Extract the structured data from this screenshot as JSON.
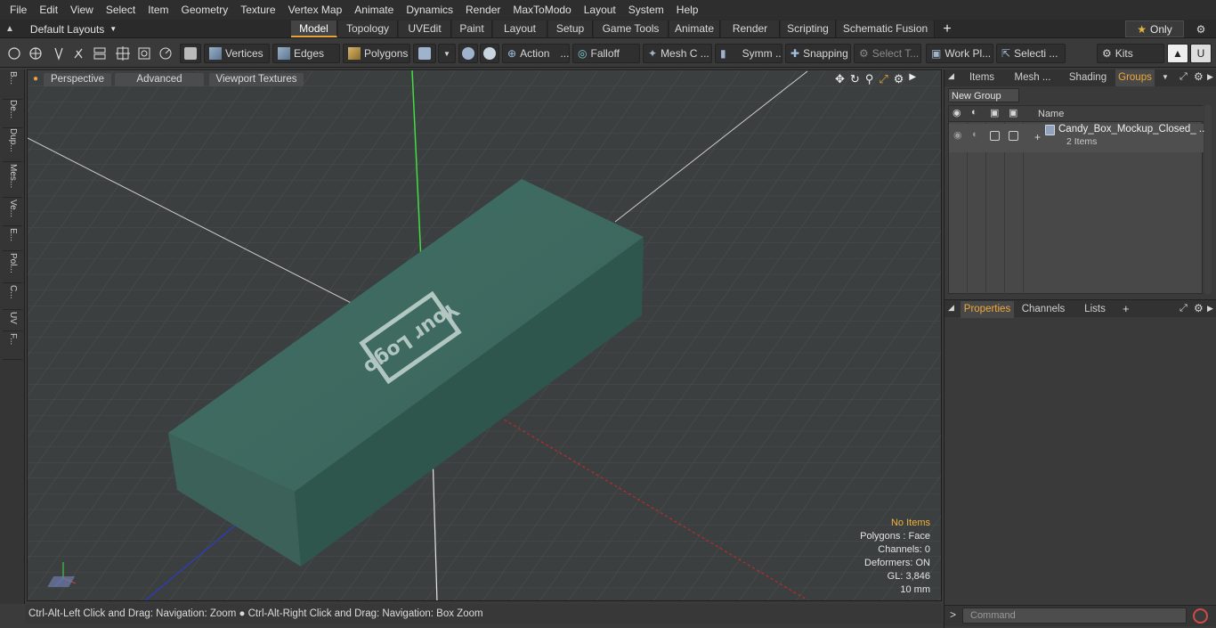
{
  "menu": [
    "File",
    "Edit",
    "View",
    "Select",
    "Item",
    "Geometry",
    "Texture",
    "Vertex Map",
    "Animate",
    "Dynamics",
    "Render",
    "MaxToModo",
    "Layout",
    "System",
    "Help"
  ],
  "layouts_label": "Default Layouts",
  "tabs": [
    "Model",
    "Topology",
    "UVEdit",
    "Paint",
    "Layout",
    "Setup",
    "Game Tools",
    "Animate",
    "Render",
    "Scripting",
    "Schematic Fusion"
  ],
  "only_label": "Only",
  "toolbar": {
    "vertices": "Vertices",
    "edges": "Edges",
    "polygons": "Polygons",
    "action": "Action",
    "falloff": "Falloff",
    "mesh": "Mesh C ...",
    "symm": "Symm ...",
    "snapping": "Snapping",
    "select_t": "Select T...",
    "work_pl": "Work Pl...",
    "selecti": "Selecti ...",
    "kits": "Kits"
  },
  "left_tools": [
    "B...",
    "De...",
    "Dup...",
    "Mes...",
    "Ve...",
    "E...",
    "Pol...",
    "C...",
    "UV",
    "F..."
  ],
  "viewport": {
    "perspective": "Perspective",
    "advanced": "Advanced",
    "textures": "Viewport Textures",
    "box_text": "Your Logo",
    "stats": [
      "No Items",
      "Polygons : Face",
      "Channels: 0",
      "Deformers: ON",
      "GL: 3,846",
      "10 mm"
    ]
  },
  "status_text": "Ctrl-Alt-Left Click and Drag: Navigation: Zoom ● Ctrl-Alt-Right Click and Drag: Navigation: Box Zoom",
  "panel_tabs": [
    "Items",
    "Mesh ...",
    "Shading",
    "Groups"
  ],
  "new_group": "New Group",
  "name_col": "Name",
  "group_item": {
    "name": "Candy_Box_Mockup_Closed_ ...",
    "count": "2 Items"
  },
  "prop_tabs": [
    "Properties",
    "Channels",
    "Lists"
  ],
  "command_placeholder": "Command",
  "colors": {
    "accent": "#e6a23c",
    "box": "#3c6a60",
    "warn": "#f0b23c"
  }
}
